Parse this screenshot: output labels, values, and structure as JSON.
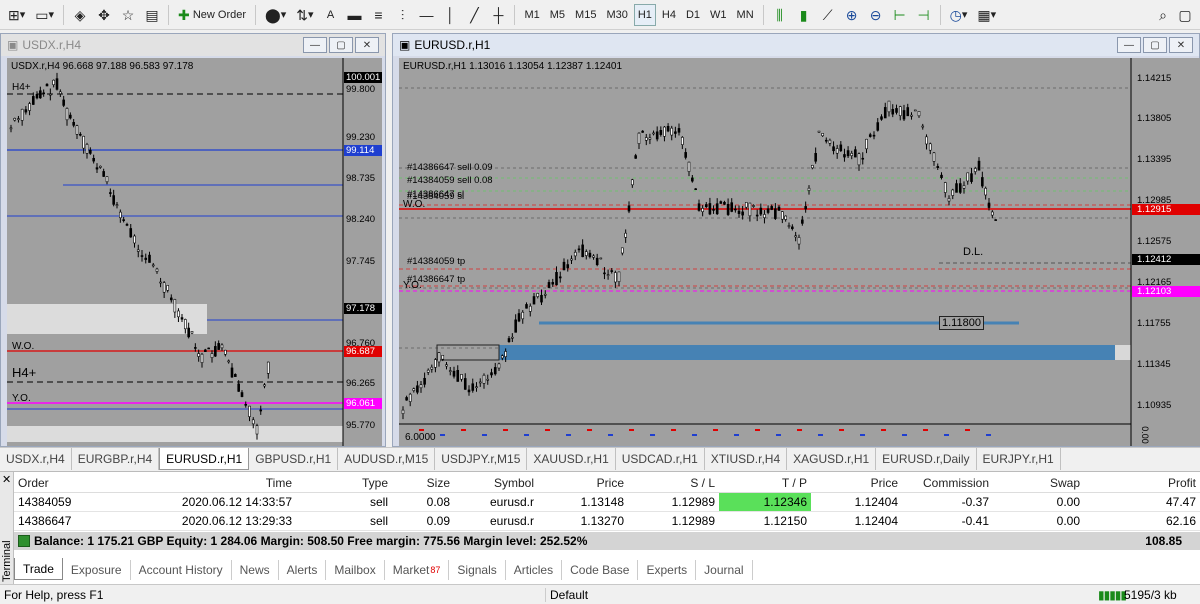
{
  "toolbar": {
    "new_order": "New Order",
    "timeframes": [
      "M1",
      "M5",
      "M15",
      "M30",
      "H1",
      "H4",
      "D1",
      "W1",
      "MN"
    ],
    "active_tf": "H1",
    "text_tool": "A"
  },
  "left_window": {
    "title": "USDX.r,H4",
    "info": "USDX.r,H4  96.668 97.188 96.583 97.178",
    "prices": [
      "100.001",
      "99.800",
      "99.230",
      "99.114",
      "98.735",
      "98.240",
      "97.745",
      "97.178",
      "96.760",
      "96.687",
      "96.265",
      "96.061",
      "95.770"
    ],
    "label_h4": "H4+",
    "label_wo": "W.O.",
    "label_h4_big": "H4+",
    "label_yo": "Y.O."
  },
  "right_window": {
    "title": "EURUSD.r,H1",
    "info": "EURUSD.r,H1  1.13016 1.13054 1.12387 1.12401",
    "prices": [
      "1.14215",
      "1.13805",
      "1.13395",
      "1.12985",
      "1.12915",
      "1.12575",
      "1.12412",
      "1.12165",
      "1.12103",
      "1.11755",
      "1.11345",
      "1.10935"
    ],
    "annotations": {
      "sell1": "#14386647 sell 0.09",
      "sell2": "#14384059 sell 0.08",
      "sl": "#14386647 sl",
      "sl2": "#14384059 sl",
      "wo": "W.O.",
      "tp1": "#14384059 tp",
      "tp2": "#14386647 tp",
      "yo": "Y.O.",
      "dl": "D.L.",
      "level": "1.11800"
    },
    "indicator": "6.0000",
    "indicator_right": "0.00"
  },
  "chart_tabs": [
    "USDX.r,H4",
    "EURGBP.r,H4",
    "EURUSD.r,H1",
    "GBPUSD.r,H1",
    "AUDUSD.r,M15",
    "USDJPY.r,M15",
    "XAUUSD.r,H1",
    "USDCAD.r,H1",
    "XTIUSD.r,H4",
    "XAGUSD.r,H1",
    "EURUSD.r,Daily",
    "EURJPY.r,H1"
  ],
  "active_chart_tab": "EURUSD.r,H1",
  "terminal": {
    "side_label": "Terminal",
    "columns": [
      "Order",
      "Time",
      "Type",
      "Size",
      "Symbol",
      "Price",
      "S / L",
      "T / P",
      "Price",
      "Commission",
      "Swap",
      "Profit"
    ],
    "rows": [
      [
        "14384059",
        "2020.06.12 14:33:57",
        "sell",
        "0.08",
        "eurusd.r",
        "1.13148",
        "1.12989",
        "1.12346",
        "1.12404",
        "-0.37",
        "0.00",
        "47.47"
      ],
      [
        "14386647",
        "2020.06.12 13:29:33",
        "sell",
        "0.09",
        "eurusd.r",
        "1.13270",
        "1.12989",
        "1.12150",
        "1.12404",
        "-0.41",
        "0.00",
        "62.16"
      ]
    ],
    "balance_line": "Balance: 1 175.21 GBP  Equity: 1 284.06  Margin: 508.50  Free margin: 775.56  Margin level: 252.52%",
    "total_profit": "108.85",
    "tabs": [
      "Trade",
      "Exposure",
      "Account History",
      "News",
      "Alerts",
      "Mailbox",
      "Market",
      "Signals",
      "Articles",
      "Code Base",
      "Experts",
      "Journal"
    ],
    "market_badge": "87"
  },
  "status": {
    "help": "For Help, press F1",
    "profile": "Default",
    "traffic": "5195/3 kb"
  },
  "colors": {
    "chart_bg": "#a0a0a0",
    "wo_line": "#e00000",
    "yo_line": "#ff00ff",
    "level_line": "#1f3fd0",
    "zone_blue": "#4682b4",
    "tp_green": "#5ae05a"
  }
}
